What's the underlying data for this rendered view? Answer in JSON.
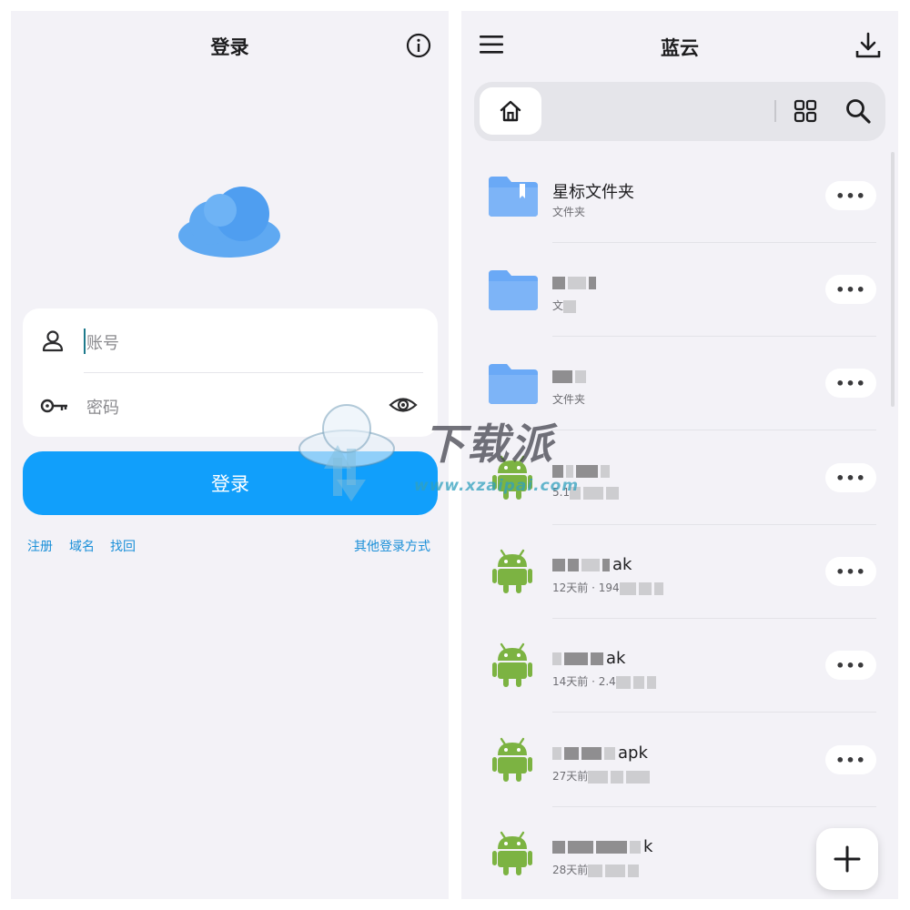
{
  "login": {
    "title": "登录",
    "account_placeholder": "账号",
    "password_placeholder": "密码",
    "login_button": "登录",
    "links": {
      "register": "注册",
      "domain": "域名",
      "recover": "找回",
      "other_login": "其他登录方式"
    },
    "icons": {
      "info": "info-circle-icon",
      "logo": "cloud-logo-icon",
      "user": "user-icon",
      "key": "key-icon",
      "eye": "eye-icon"
    }
  },
  "browser": {
    "title": "蓝云",
    "icons": {
      "menu": "menu-icon",
      "download": "download-icon",
      "home": "home-icon",
      "grid": "grid-view-icon",
      "search": "search-icon",
      "add": "plus-icon"
    },
    "files": [
      {
        "type": "folder-starred",
        "name": "星标文件夹",
        "meta": "文件夹"
      },
      {
        "type": "folder",
        "name": "",
        "meta": "文"
      },
      {
        "type": "folder",
        "name": "",
        "meta": "文件夹"
      },
      {
        "type": "apk",
        "name": "",
        "meta": "5.1"
      },
      {
        "type": "apk",
        "name": "ak",
        "meta": "12天前 · 194"
      },
      {
        "type": "apk",
        "name": "ak",
        "meta": "14天前 · 2.4"
      },
      {
        "type": "apk",
        "name": "apk",
        "meta": "27天前"
      },
      {
        "type": "apk",
        "name": "k",
        "meta": "28天前"
      }
    ],
    "more_label": "•••"
  },
  "watermark": {
    "text": "下载派",
    "url": "www.xzaipai.com"
  },
  "colors": {
    "accent": "#119ffb",
    "link": "#1a8fd8",
    "folder": "#6aa9f6",
    "android": "#7cb342",
    "background": "#f3f2f7"
  }
}
